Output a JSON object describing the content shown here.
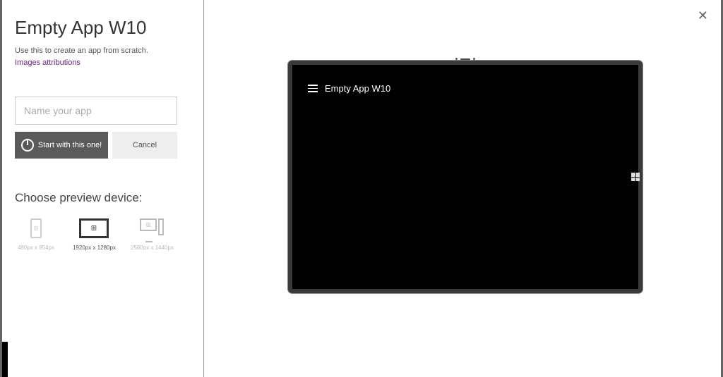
{
  "header": {
    "title": "Empty App W10",
    "subtitle": "Use this to create an app from scratch.",
    "attributions_link": "Images attributions"
  },
  "form": {
    "name_placeholder": "Name your app",
    "start_label": "Start with this one!",
    "cancel_label": "Cancel"
  },
  "devices": {
    "heading": "Choose preview device:",
    "options": [
      {
        "label": "480px x 854px"
      },
      {
        "label": "1920px x 1280px"
      },
      {
        "label": "2560px x 1440px"
      }
    ]
  },
  "preview": {
    "app_title": "Empty App W10"
  },
  "close_glyph": "✕"
}
